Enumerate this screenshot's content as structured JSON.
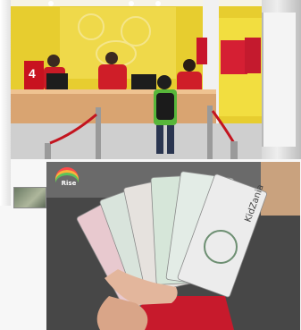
{
  "top_photo": {
    "counter_number": "4"
  },
  "bottom_photo": {
    "badge_text": "Rise",
    "banknote_text": "KidZania"
  }
}
